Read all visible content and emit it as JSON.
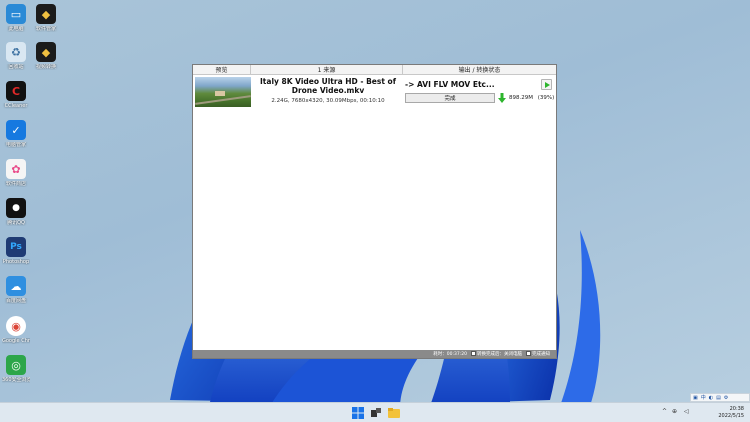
{
  "desktop": {
    "icons": [
      {
        "label": "此电脑",
        "color": "#2a8ad6",
        "glyph": "▭"
      },
      {
        "label": "软件管家",
        "color": "#1b1b1b",
        "glyph": "◆"
      },
      {
        "label": "回收站",
        "color": "#d9e7f2",
        "glyph": "♻"
      },
      {
        "label": "视频转换",
        "color": "#1b1b1b",
        "glyph": "◆"
      },
      {
        "label": "CCleaner",
        "color": "#111111",
        "glyph": "C"
      },
      {
        "label": "电脑管家",
        "color": "#1679e0",
        "glyph": "✓"
      },
      {
        "label": "软件商店",
        "color": "#f5f5f5",
        "glyph": "✿"
      },
      {
        "label": "腾讯QQ",
        "color": "#111111",
        "glyph": "🐧"
      },
      {
        "label": "Photoshop",
        "color": "#1f3b74",
        "glyph": "Ps"
      },
      {
        "label": "百度网盘",
        "color": "#2f8fe0",
        "glyph": "☁"
      },
      {
        "label": "Google Chrome",
        "color": "#ffffff",
        "glyph": "◉"
      },
      {
        "label": "360安全浏览器",
        "color": "#2da64a",
        "glyph": "◎"
      }
    ]
  },
  "app": {
    "columns": {
      "preview": "预览",
      "source": "1 来源",
      "output": "输出 / 转换状态"
    },
    "task": {
      "title": "Italy 8K Video Ultra HD - Best of Drone Video.mkv",
      "meta": "2.24G, 7680x4320, 30.09Mbps, 00:10:10",
      "output_format": "-> AVI FLV MOV Etc...",
      "status_button": "完成",
      "output_size": "898.29M",
      "progress_percent": "(39%)"
    },
    "statusbar": {
      "elapsed": "耗时：00:37:20",
      "after_done": "转换完成后：关闭电脑",
      "sound": "完成通知"
    }
  },
  "taskbar": {
    "clock_time": "20:38",
    "clock_date": "2022/5/15",
    "ime_label": "中"
  },
  "colors": {
    "accent_green": "#2db52d",
    "statusbar_bg": "#8a8a8a"
  }
}
